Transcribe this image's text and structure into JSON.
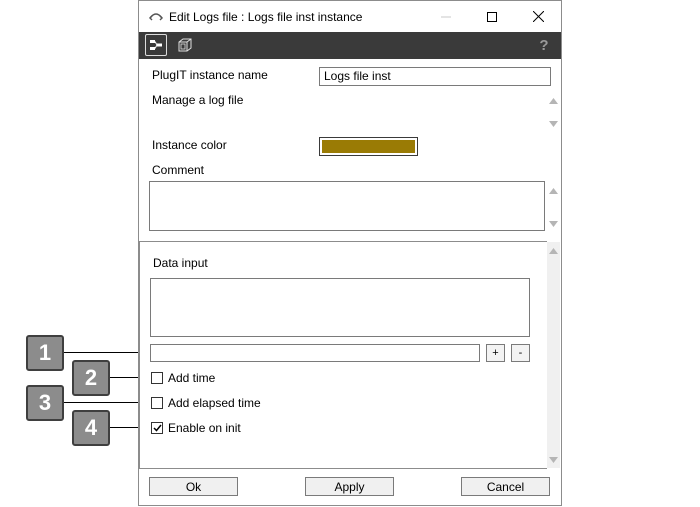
{
  "window": {
    "title": "Edit Logs file : Logs file inst instance"
  },
  "toolbar": {
    "icons": [
      "node-structure-icon",
      "cube-icon",
      "help-icon"
    ]
  },
  "form": {
    "instance_name_label": "PlugIT instance name",
    "instance_name_value": "Logs file inst",
    "description": "Manage a log file",
    "instance_color_label": "Instance color",
    "instance_color_value": "#9a7b05",
    "comment_label": "Comment",
    "comment_value": ""
  },
  "params": {
    "data_input_label": "Data input",
    "data_input_value": "",
    "add_button": "+",
    "remove_button": "-",
    "checkboxes": [
      {
        "label": "Add time",
        "checked": false
      },
      {
        "label": "Add elapsed time",
        "checked": false
      },
      {
        "label": "Enable on init",
        "checked": true
      }
    ]
  },
  "buttons": {
    "ok": "Ok",
    "apply": "Apply",
    "cancel": "Cancel"
  },
  "callouts": [
    "1",
    "2",
    "3",
    "4"
  ]
}
